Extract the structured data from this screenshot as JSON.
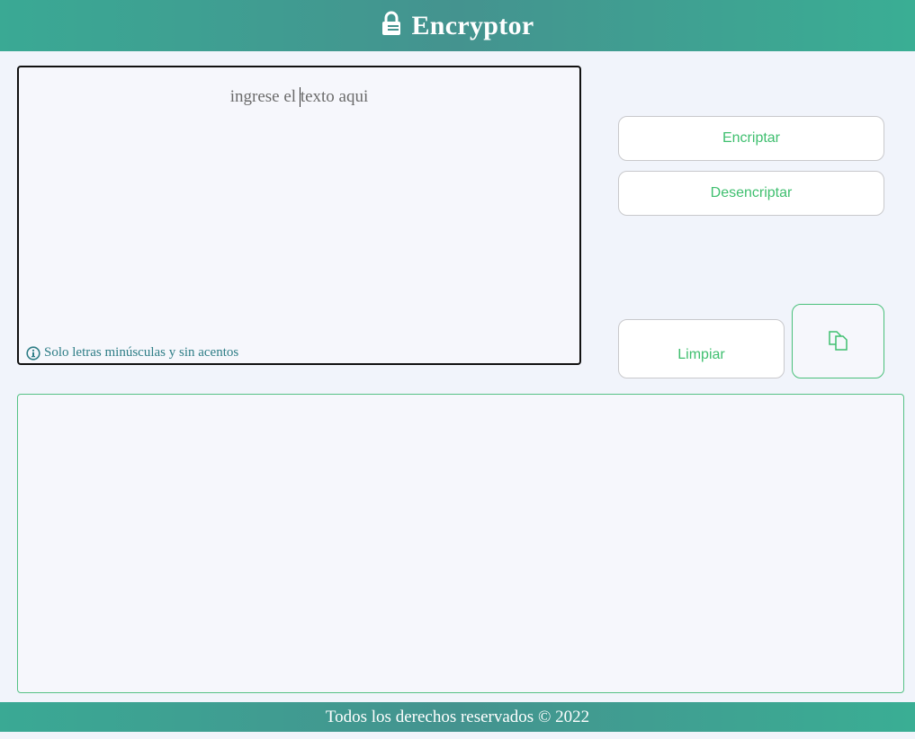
{
  "header": {
    "title": "Encryptor",
    "icon": "lock-icon"
  },
  "input": {
    "placeholder": "ingrese el texto aqui",
    "value": "",
    "hint": "Solo letras minúsculas y sin acentos",
    "hint_icon": "info-icon"
  },
  "buttons": {
    "encrypt_label": "Encriptar",
    "decrypt_label": "Desencriptar",
    "clear_label": "Limpiar",
    "copy_icon": "copy-icon"
  },
  "output": {
    "value": ""
  },
  "footer": {
    "text": "Todos los derechos reservados © 2022"
  },
  "colors": {
    "header_bg": "#3aa994",
    "accent": "#3fbf6f",
    "hint": "#2e7d86",
    "output_border": "#56c286"
  }
}
